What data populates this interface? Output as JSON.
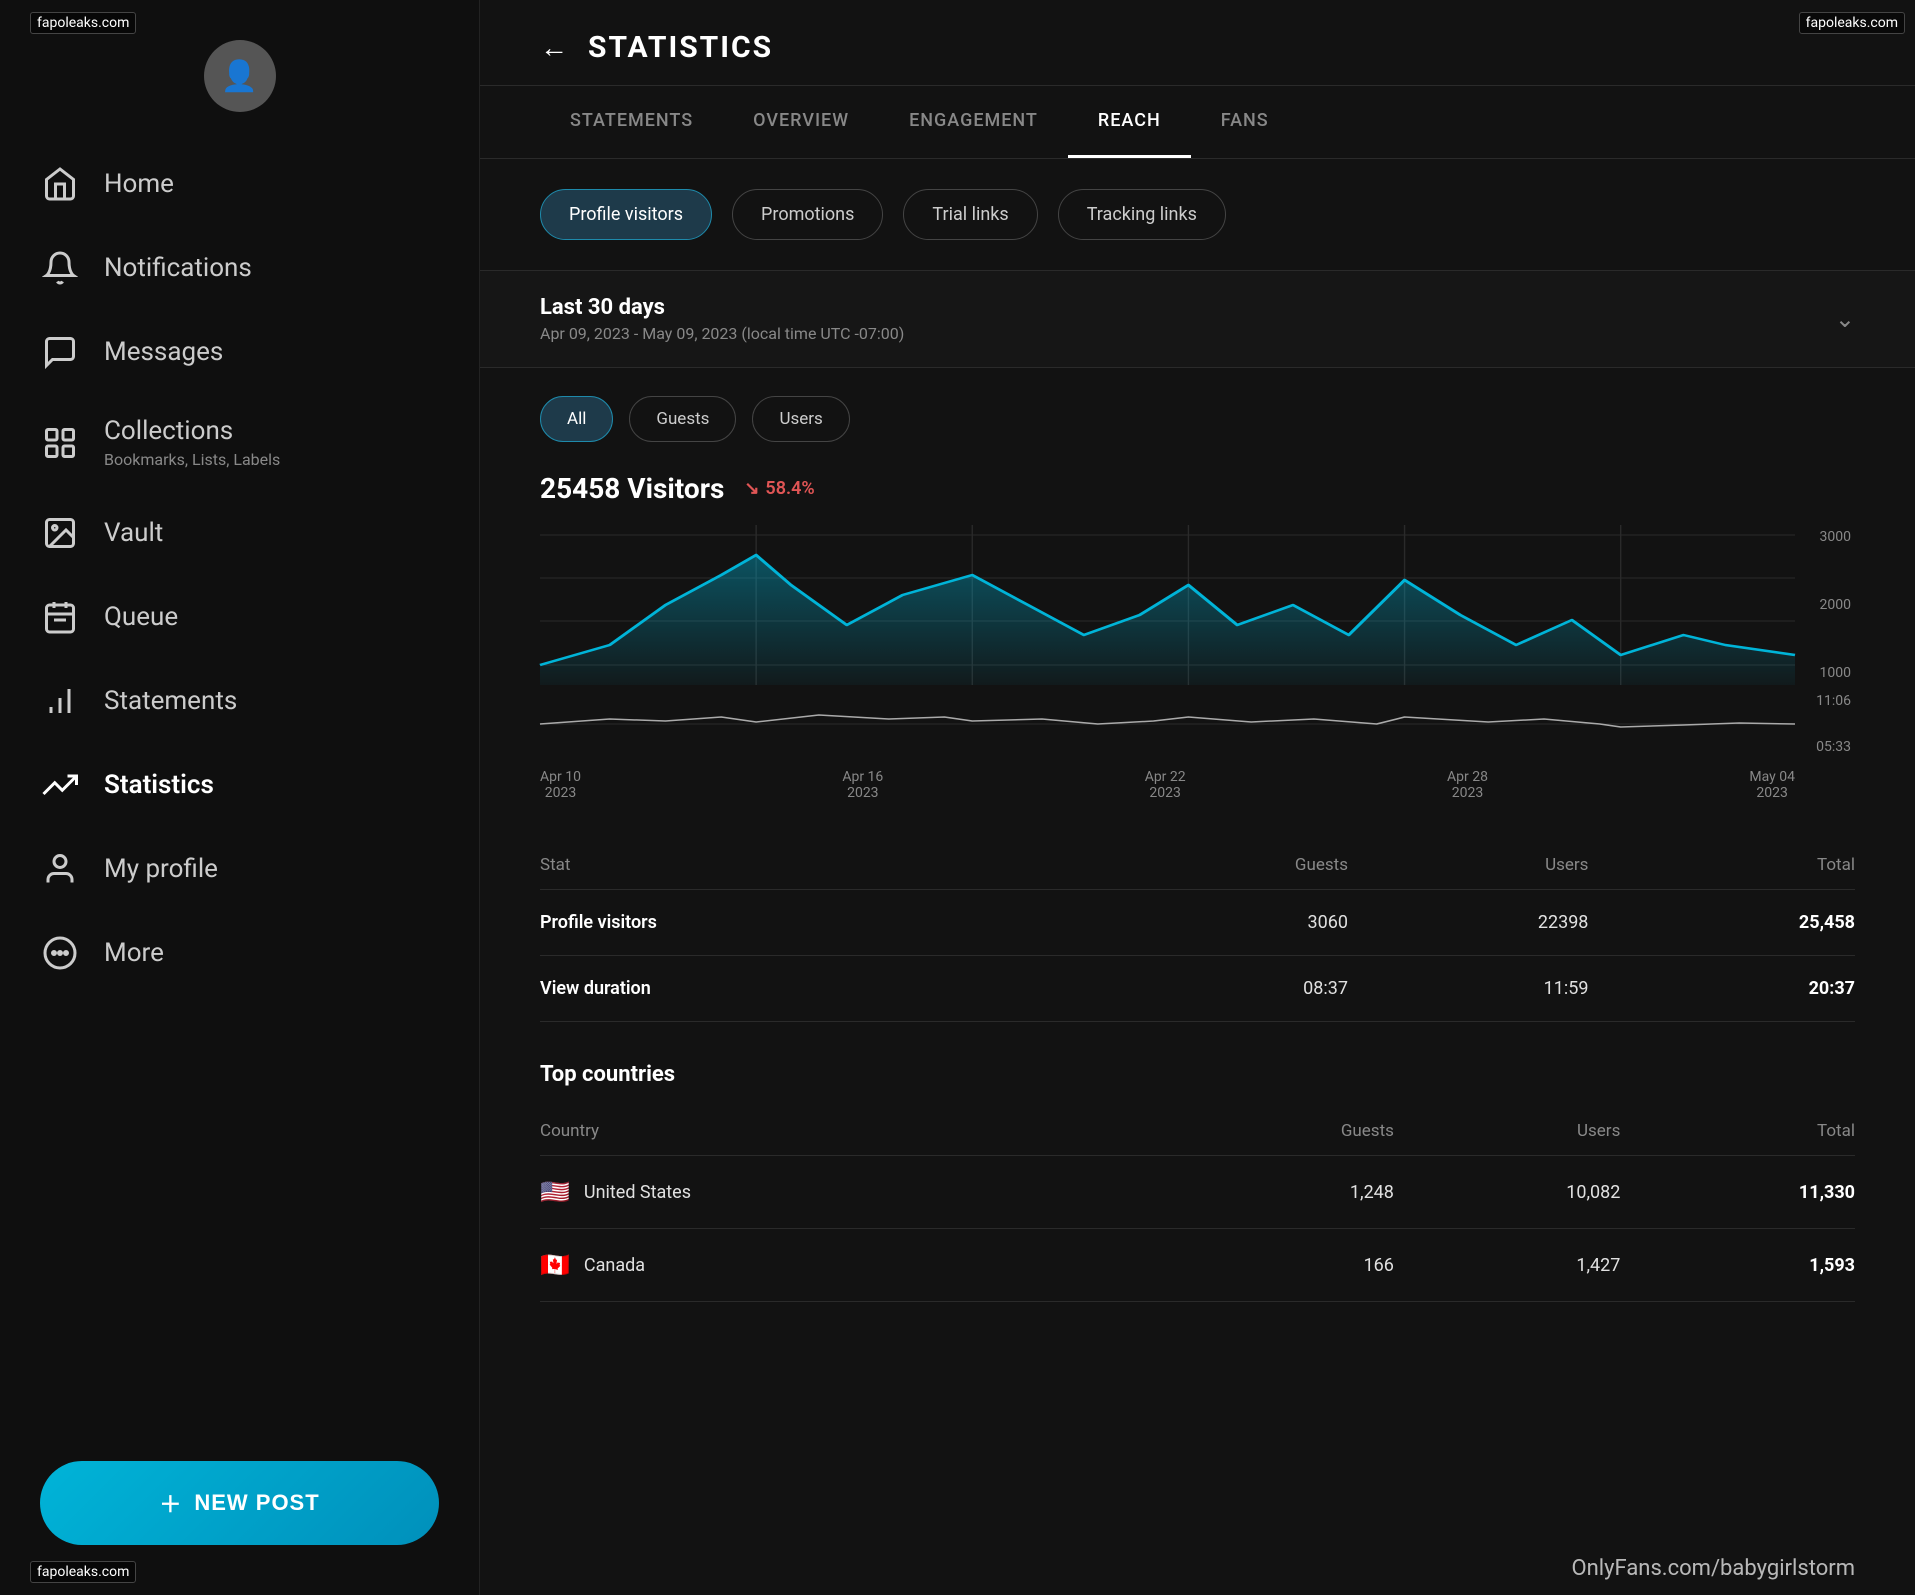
{
  "watermarks": {
    "top_left": "fapoleaks.com",
    "top_right": "fapoleaks.com",
    "bottom_left": "fapoleaks.com",
    "side_left": "fapoleaks.com",
    "side_right": "fapoleaks.com"
  },
  "sidebar": {
    "nav_items": [
      {
        "id": "home",
        "label": "Home",
        "icon": "home"
      },
      {
        "id": "notifications",
        "label": "Notifications",
        "icon": "bell"
      },
      {
        "id": "messages",
        "label": "Messages",
        "icon": "message"
      },
      {
        "id": "collections",
        "label": "Collections",
        "sub": "Bookmarks, Lists, Labels",
        "icon": "grid"
      },
      {
        "id": "vault",
        "label": "Vault",
        "icon": "image"
      },
      {
        "id": "queue",
        "label": "Queue",
        "icon": "calendar"
      },
      {
        "id": "statements",
        "label": "Statements",
        "icon": "bar-chart"
      },
      {
        "id": "statistics",
        "label": "Statistics",
        "icon": "trending-up",
        "active": true
      },
      {
        "id": "my-profile",
        "label": "My profile",
        "icon": "user"
      },
      {
        "id": "more",
        "label": "More",
        "icon": "more-circle"
      }
    ],
    "new_post_label": "NEW POST"
  },
  "header": {
    "title": "STATISTICS",
    "back_label": "←"
  },
  "tabs": [
    {
      "id": "statements",
      "label": "STATEMENTS",
      "active": false
    },
    {
      "id": "overview",
      "label": "OVERVIEW",
      "active": false
    },
    {
      "id": "engagement",
      "label": "ENGAGEMENT",
      "active": false
    },
    {
      "id": "reach",
      "label": "REACH",
      "active": true
    },
    {
      "id": "fans",
      "label": "FANS",
      "active": false
    }
  ],
  "filter_pills": [
    {
      "id": "profile-visitors",
      "label": "Profile visitors",
      "active": true
    },
    {
      "id": "promotions",
      "label": "Promotions",
      "active": false
    },
    {
      "id": "trial-links",
      "label": "Trial links",
      "active": false
    },
    {
      "id": "tracking-links",
      "label": "Tracking links",
      "active": false
    }
  ],
  "date_range": {
    "label": "Last 30 days",
    "sub": "Apr 09, 2023 - May 09, 2023 (local time UTC -07:00)"
  },
  "visitor_pills": [
    {
      "id": "all",
      "label": "All",
      "active": true
    },
    {
      "id": "guests",
      "label": "Guests",
      "active": false
    },
    {
      "id": "users",
      "label": "Users",
      "active": false
    }
  ],
  "visitors": {
    "count": "25458 Visitors",
    "change": "↘ 58.4%",
    "change_color": "#e05555"
  },
  "chart": {
    "y_labels": [
      "3000",
      "2000",
      "1000"
    ],
    "x_labels": [
      {
        "date": "Apr 10",
        "year": "2023"
      },
      {
        "date": "Apr 16",
        "year": "2023"
      },
      {
        "date": "Apr 22",
        "year": "2023"
      },
      {
        "date": "Apr 28",
        "year": "2023"
      },
      {
        "date": "May 04",
        "year": "2023"
      }
    ],
    "time_labels": [
      "11:06",
      "05:33"
    ]
  },
  "stats_table": {
    "columns": [
      "Stat",
      "Guests",
      "Users",
      "Total"
    ],
    "rows": [
      {
        "stat": "Profile visitors",
        "guests": "3060",
        "users": "22398",
        "total": "25,458"
      },
      {
        "stat": "View duration",
        "guests": "08:37",
        "users": "11:59",
        "total": "20:37"
      }
    ]
  },
  "top_countries": {
    "title": "Top countries",
    "columns": [
      "Country",
      "Guests",
      "Users",
      "Total"
    ],
    "rows": [
      {
        "flag": "🇺🇸",
        "country": "United States",
        "guests": "1,248",
        "users": "10,082",
        "total": "11,330"
      },
      {
        "flag": "🇨🇦",
        "country": "Canada",
        "guests": "166",
        "users": "1,427",
        "total": "1,593"
      }
    ]
  },
  "bottom_watermark": "OnlyFans.com/babygirlstorm"
}
